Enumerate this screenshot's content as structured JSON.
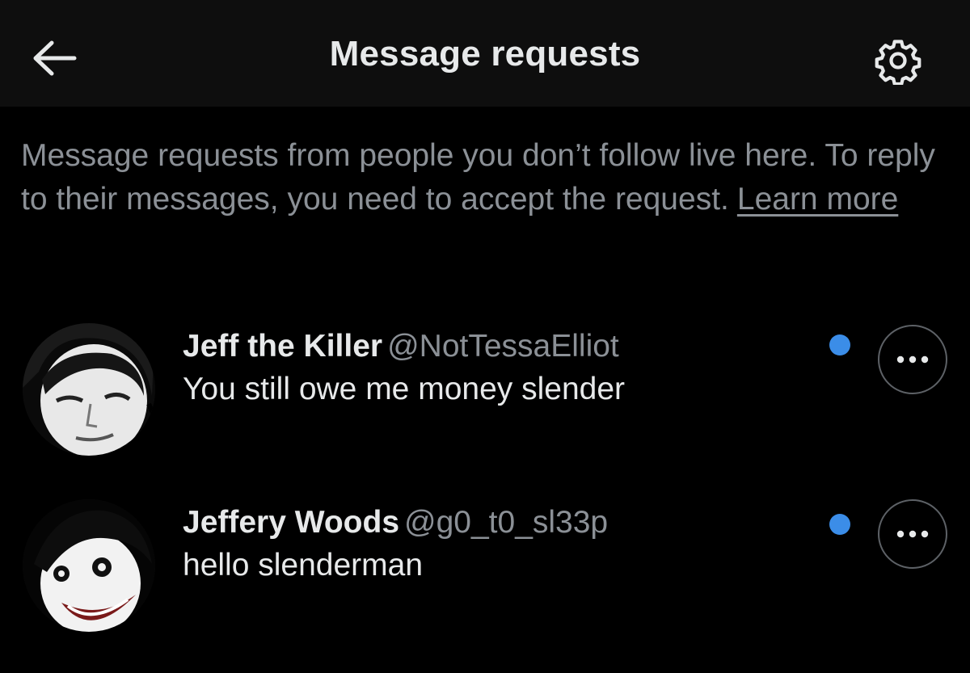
{
  "header": {
    "title": "Message requests",
    "back_icon": "arrow-left-icon",
    "settings_icon": "gear-icon"
  },
  "intro": {
    "text": "Message requests from people you don’t follow live here. To reply to their messages, you need to accept the request.",
    "learn_more": "Learn more"
  },
  "requests": [
    {
      "name": "Jeff the Killer",
      "handle": "@NotTessaElliot",
      "message": "You still owe me money slender",
      "unread": true,
      "more_icon": "more-horizontal-icon"
    },
    {
      "name": "Jeffery Woods",
      "handle": "@g0_t0_sl33p",
      "message": "hello slenderman",
      "unread": true,
      "more_icon": "more-horizontal-icon"
    }
  ],
  "colors": {
    "background": "#000000",
    "header_background": "#0e0e0e",
    "primary_text": "#e7e9ea",
    "secondary_text": "#8b9096",
    "unread_dot": "#3b8de8",
    "button_border": "#5d6166"
  }
}
